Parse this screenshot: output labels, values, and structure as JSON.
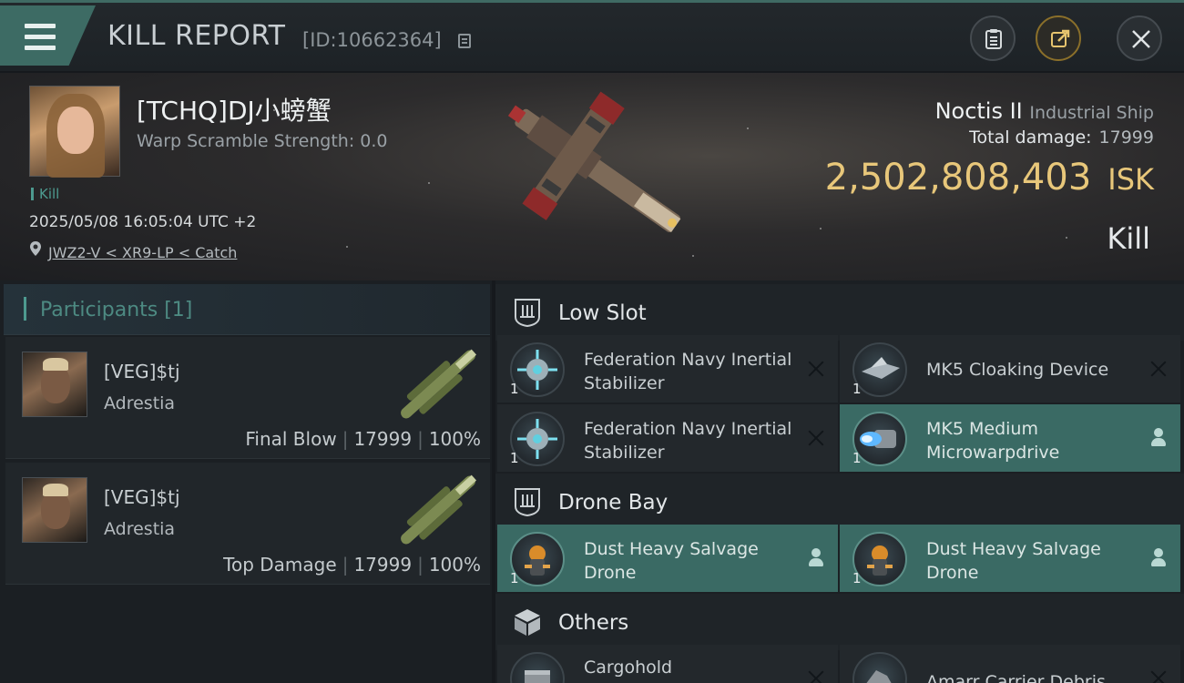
{
  "header": {
    "title": "KILL REPORT",
    "report_id": "[ID:10662364]"
  },
  "victim": {
    "name": "[TCHQ]DJ小螃蟹",
    "warp_scramble": "Warp Scramble Strength: 0.0",
    "tag": "Kill",
    "datetime": "2025/05/08 16:05:04 UTC +2",
    "location": "JWZ2-V < XR9-LP < Catch",
    "ship_name": "Noctis II",
    "ship_class": "Industrial Ship",
    "total_damage_label": "Total damage:",
    "total_damage": "17999",
    "isk_value": "2,502,808,403",
    "isk_label": "ISK",
    "result": "Kill"
  },
  "participants": {
    "tab_label": "Participants [1]",
    "items": [
      {
        "name": "[VEG]$tj",
        "ship": "Adrestia",
        "role": "Final Blow",
        "damage": "17999",
        "percent": "100%"
      },
      {
        "name": "[VEG]$tj",
        "ship": "Adrestia",
        "role": "Top Damage",
        "damage": "17999",
        "percent": "100%"
      }
    ]
  },
  "sections": {
    "low_slot": "Low Slot",
    "drone_bay": "Drone Bay",
    "others": "Others"
  },
  "items": {
    "low_1": {
      "name": "Federation Navy Inertial Stabilizer",
      "qty": "1",
      "icon": "stabilizer-icon",
      "status": "destroyed"
    },
    "low_2": {
      "name": "MK5 Cloaking Device",
      "qty": "1",
      "icon": "cloaking-device-icon",
      "status": "destroyed"
    },
    "low_3": {
      "name": "Federation Navy Inertial Stabilizer",
      "qty": "1",
      "icon": "stabilizer-icon",
      "status": "destroyed"
    },
    "low_4": {
      "name": "MK5 Medium Microwarpdrive",
      "qty": "1",
      "icon": "microwarpdrive-icon",
      "status": "dropped"
    },
    "drone_1": {
      "name": "Dust Heavy Salvage Drone",
      "qty": "1",
      "icon": "salvage-drone-icon",
      "status": "dropped"
    },
    "drone_2": {
      "name": "Dust Heavy Salvage Drone",
      "qty": "1",
      "icon": "salvage-drone-icon",
      "status": "dropped"
    },
    "other_1": {
      "name": "Cargohold",
      "icon": "cargohold-icon",
      "status": "destroyed"
    },
    "other_2": {
      "name": "Amarr Carrier Debris",
      "icon": "debris-icon",
      "status": "destroyed"
    }
  },
  "colors": {
    "accent_teal": "#3d6b64",
    "fitted_item_bg": "#3a6a64",
    "isk_gold": "#e8c77a"
  }
}
